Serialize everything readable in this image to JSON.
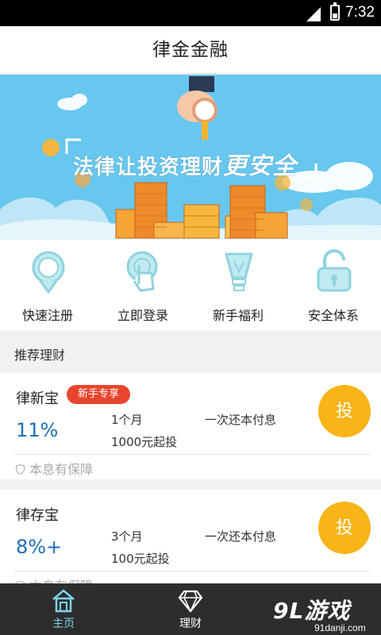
{
  "status_bar": {
    "time": "7:32"
  },
  "header": {
    "title": "律金金融"
  },
  "banner": {
    "slogan_main": "法律让投资理财",
    "slogan_emphasis": "更安全"
  },
  "quick_menu": [
    {
      "label": "快速注册",
      "icon": "location-pin-icon"
    },
    {
      "label": "立即登录",
      "icon": "touch-hand-icon"
    },
    {
      "label": "新手福利",
      "icon": "lightbulb-icon"
    },
    {
      "label": "安全体系",
      "icon": "padlock-icon"
    }
  ],
  "recommend": {
    "section_title": "推荐理财",
    "products": [
      {
        "name": "律新宝",
        "badge": "新手专享",
        "rate": "11%",
        "period": "1个月",
        "min_amount": "1000元起投",
        "repayment": "一次还本付息",
        "invest_label": "投",
        "guarantee": "本息有保障"
      },
      {
        "name": "律存宝",
        "rate": "8%+",
        "period": "3个月",
        "min_amount": "100元起投",
        "repayment": "一次还本付息",
        "invest_label": "投",
        "guarantee": "本息有保障"
      }
    ]
  },
  "tab_bar": [
    {
      "label": "主页",
      "icon": "house-icon",
      "active": true
    },
    {
      "label": "理财",
      "icon": "diamond-icon",
      "active": false
    }
  ],
  "watermark": {
    "main": "9L游戏",
    "sub": "91danji.com"
  },
  "colors": {
    "accent_blue": "#1d6fb8",
    "invest_yellow": "#f9b418",
    "badge_red": "#e8452e",
    "icon_teal": "#8fd3df"
  }
}
